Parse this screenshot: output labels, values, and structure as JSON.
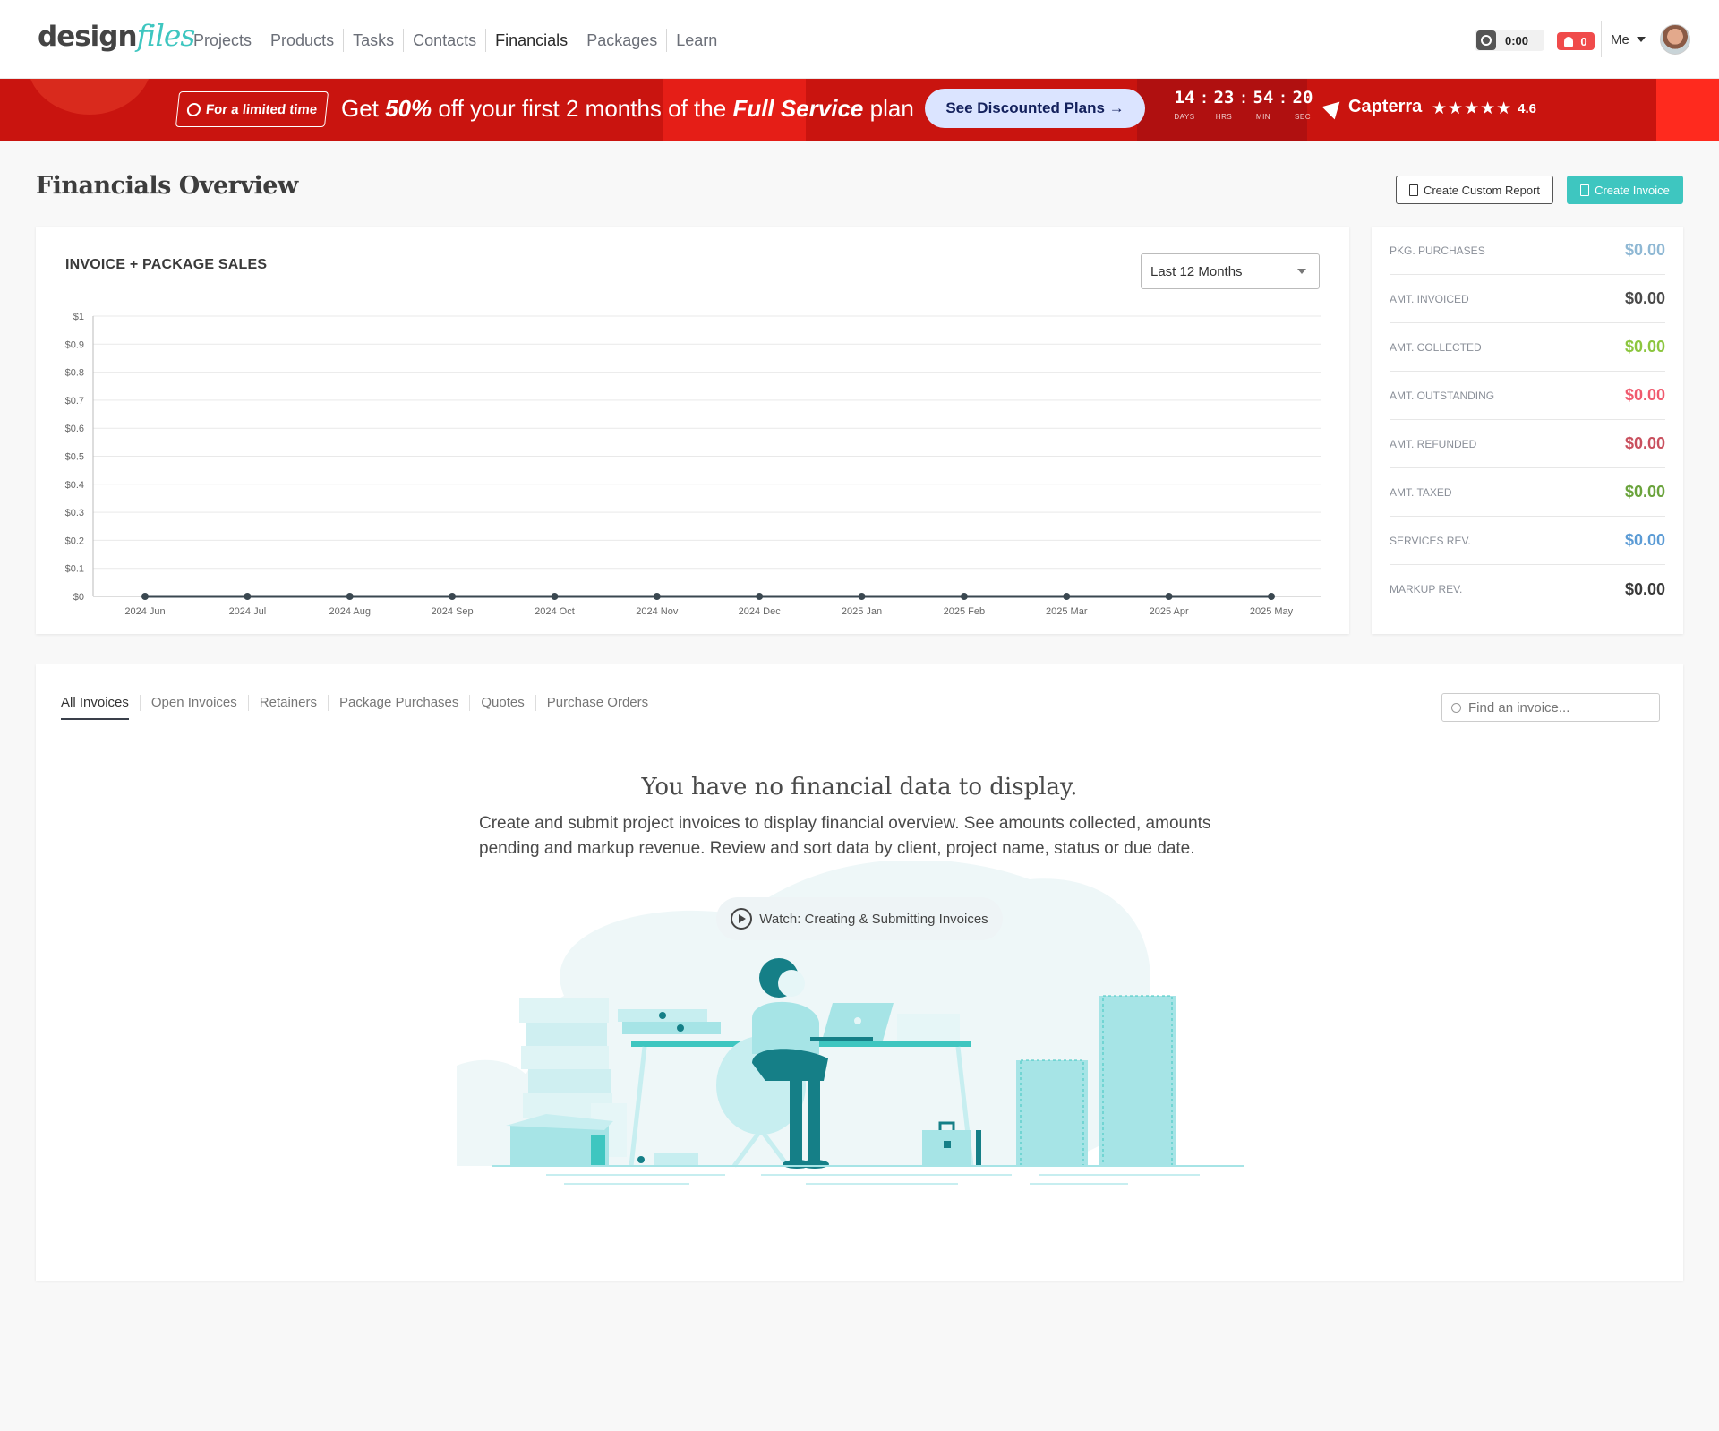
{
  "logo": {
    "part1": "design",
    "part2": "files"
  },
  "nav": {
    "items": [
      {
        "label": "Projects"
      },
      {
        "label": "Products"
      },
      {
        "label": "Tasks"
      },
      {
        "label": "Contacts"
      },
      {
        "label": "Financials"
      },
      {
        "label": "Packages"
      },
      {
        "label": "Learn"
      }
    ],
    "active": "Financials"
  },
  "header": {
    "timer": "0:00",
    "notifications": "0",
    "user": "Me"
  },
  "promo": {
    "tag": "For a limited time",
    "text_prefix": "Get ",
    "text_discount": "50%",
    "text_mid": " off your first 2 months of the ",
    "text_plan": "Full Service",
    "text_suffix": " plan",
    "button": "See Discounted Plans →",
    "countdown": {
      "days": "14",
      "hours": "23",
      "minutes": "54",
      "seconds": "20",
      "days_label": "DAYS",
      "hours_label": "HRS",
      "minutes_label": "MIN",
      "seconds_label": "SEC"
    },
    "review_site": "Capterra",
    "stars": "★★★★★",
    "rating": "4.6"
  },
  "page": {
    "title": "Financials Overview",
    "btn_report": "Create Custom Report",
    "btn_invoice": "Create Invoice"
  },
  "chart_panel": {
    "title": "INVOICE + PACKAGE SALES",
    "range": "Last 12 Months"
  },
  "chart_data": {
    "type": "line",
    "title": "INVOICE + PACKAGE SALES",
    "xlabel": "",
    "ylabel": "",
    "categories": [
      "2024 Jun",
      "2024 Jul",
      "2024 Aug",
      "2024 Sep",
      "2024 Oct",
      "2024 Nov",
      "2024 Dec",
      "2025 Jan",
      "2025 Feb",
      "2025 Mar",
      "2025 Apr",
      "2025 May"
    ],
    "values": [
      0,
      0,
      0,
      0,
      0,
      0,
      0,
      0,
      0,
      0,
      0,
      0
    ],
    "y_ticks": [
      "$0",
      "$0.1",
      "$0.2",
      "$0.3",
      "$0.4",
      "$0.5",
      "$0.6",
      "$0.7",
      "$0.8",
      "$0.9",
      "$1"
    ],
    "ylim": [
      0,
      1
    ],
    "grid": true,
    "line_color": "#3a4750"
  },
  "stats": [
    {
      "label": "PKG. PURCHASES",
      "value": "$0.00",
      "color": "#8fb8d4"
    },
    {
      "label": "AMT. INVOICED",
      "value": "$0.00",
      "color": "#4a4a4a"
    },
    {
      "label": "AMT. COLLECTED",
      "value": "$0.00",
      "color": "#8cc63f"
    },
    {
      "label": "AMT. OUTSTANDING",
      "value": "$0.00",
      "color": "#f05a6e"
    },
    {
      "label": "AMT. REFUNDED",
      "value": "$0.00",
      "color": "#c9505e"
    },
    {
      "label": "AMT. TAXED",
      "value": "$0.00",
      "color": "#6aa33c"
    },
    {
      "label": "SERVICES REV.",
      "value": "$0.00",
      "color": "#5b9bd5"
    },
    {
      "label": "MARKUP REV.",
      "value": "$0.00",
      "color": "#3a3a3a"
    }
  ],
  "invoices": {
    "tabs": [
      {
        "label": "All Invoices"
      },
      {
        "label": "Open Invoices"
      },
      {
        "label": "Retainers"
      },
      {
        "label": "Package Purchases"
      },
      {
        "label": "Quotes"
      },
      {
        "label": "Purchase Orders"
      }
    ],
    "search_placeholder": "Find an invoice...",
    "empty_title": "You have no financial data to display.",
    "empty_desc": "Create and submit project invoices to display financial overview. See amounts collected, amounts pending and markup revenue. Review and sort data by client, project name, status or due date.",
    "watch_label": "Watch: Creating & Submitting Invoices"
  },
  "colors": {
    "accent": "#3ec6c0",
    "promo_bg": "#c9140f",
    "illustration_primary": "#157f87",
    "illustration_light": "#a6e4e6"
  }
}
